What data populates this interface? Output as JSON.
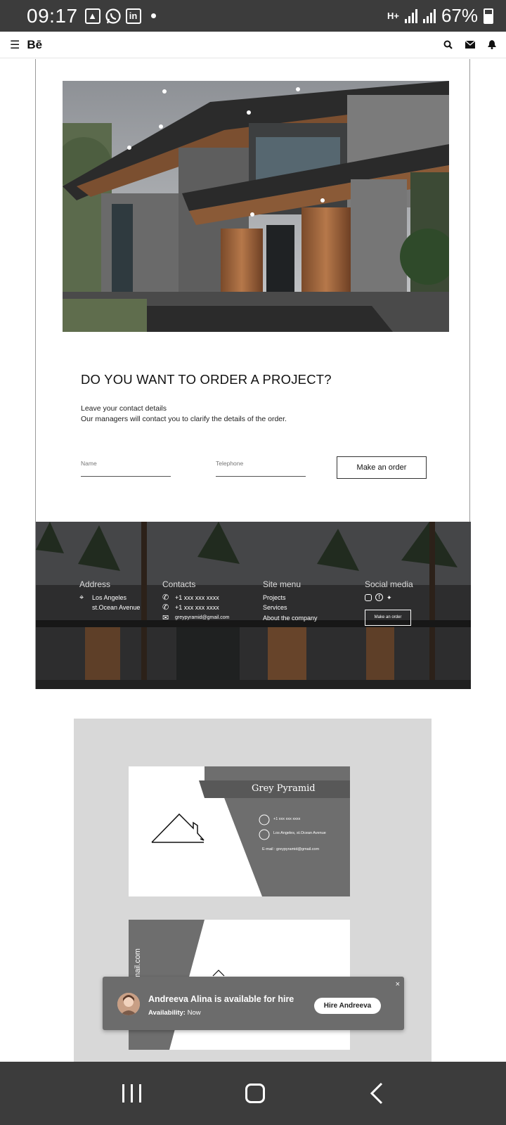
{
  "status_bar": {
    "time": "09:17",
    "battery": "67%",
    "network": "H+"
  },
  "app_bar": {
    "logo": "Bē"
  },
  "order": {
    "title": "DO YOU WANT TO ORDER A PROJECT?",
    "line1": "Leave your contact details",
    "line2": "Our managers will contact you to clarify the details of the order.",
    "name_placeholder": "Name",
    "phone_placeholder": "Telephone",
    "button_label": "Make an order"
  },
  "footer": {
    "address": {
      "title": "Address",
      "line1": "Los Angeles",
      "line2": "st.Ocean Avenue"
    },
    "contacts": {
      "title": "Contacts",
      "phone1": "+1 xxx xxx xxxx",
      "phone2": "+1 xxx xxx xxxx",
      "email": "greypyramid@gmail.com"
    },
    "site_menu": {
      "title": "Site menu",
      "items": [
        "Projects",
        "Services",
        "About the company"
      ]
    },
    "social": {
      "title": "Social media",
      "button_label": "Make an order"
    }
  },
  "business_card": {
    "company": "Grey Pyramid",
    "phone": "+1 xxx xxx xxxx",
    "address": "Los Angeles, st.Ocean Avenue",
    "email": "E-mail : greypyramid@gmail.com",
    "vertical_text": "gmail.com"
  },
  "hire_popup": {
    "title": "Andreeva Alina is available for hire",
    "availability_label": "Availability:",
    "availability_value": "Now",
    "button_label": "Hire Andreeva",
    "close": "×"
  },
  "colors": {
    "accent": "#1769ff",
    "card_gray": "#6e6e6e",
    "panel_gray": "#d8d8d8",
    "system_bar": "#3c3c3c"
  }
}
